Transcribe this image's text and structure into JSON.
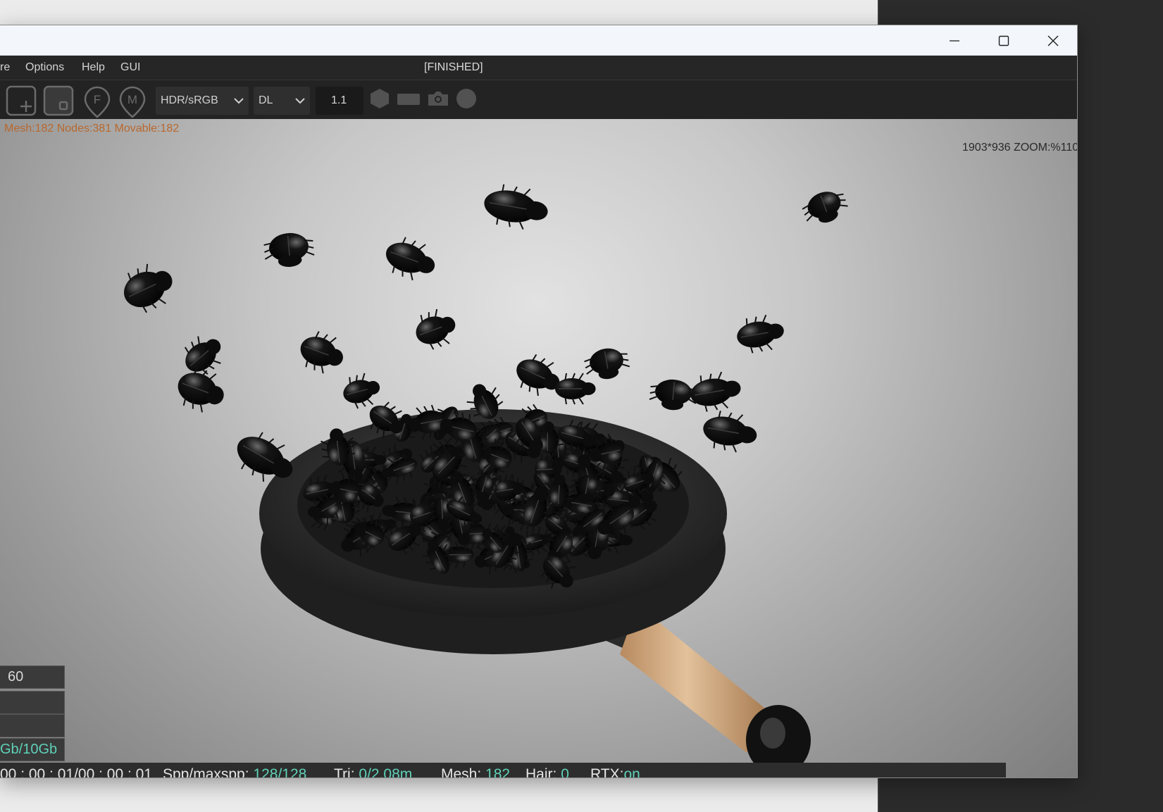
{
  "window": {
    "controls": {
      "minimize_icon": "minimize-icon",
      "maximize_icon": "maximize-icon",
      "close_icon": "close-icon"
    }
  },
  "menu": {
    "items": [
      "re",
      "Options",
      "Help",
      "GUI"
    ],
    "status": "[FINISHED]"
  },
  "toolbar": {
    "icons": [
      "add-scene-icon",
      "frame-select-icon",
      "f-pin-icon",
      "m-pin-icon"
    ],
    "display_dropdown": "HDR/sRGB",
    "mode_dropdown": "DL",
    "value": "1.1",
    "disabled_icons": [
      "hexagon-icon",
      "rectangle-light-icon",
      "camera-icon",
      "sphere-icon"
    ]
  },
  "viewport": {
    "scene_stats": "Mesh:182 Nodes:381 Movable:182",
    "zoom_readout": "1903*936 ZOOM:%110",
    "side_fields": {
      "fps": "60",
      "memory": "Gb/10Gb"
    }
  },
  "render_status": {
    "time": "00 : 00 : 01/00 : 00 : 01",
    "spp_label": "Spp/maxspp:",
    "spp_value": "128/128",
    "tri_label": "Tri:",
    "tri_value": "0/2.08m",
    "mesh_label": "Mesh:",
    "mesh_value": "182",
    "hair_label": "Hair:",
    "hair_value": "0",
    "rtx_label": "RTX:",
    "rtx_value": "on",
    "progress": 1.0
  },
  "colors": {
    "accent_teal": "#5fd1b8",
    "progress_green": "#43d45a",
    "stats_orange": "#b8682e"
  }
}
